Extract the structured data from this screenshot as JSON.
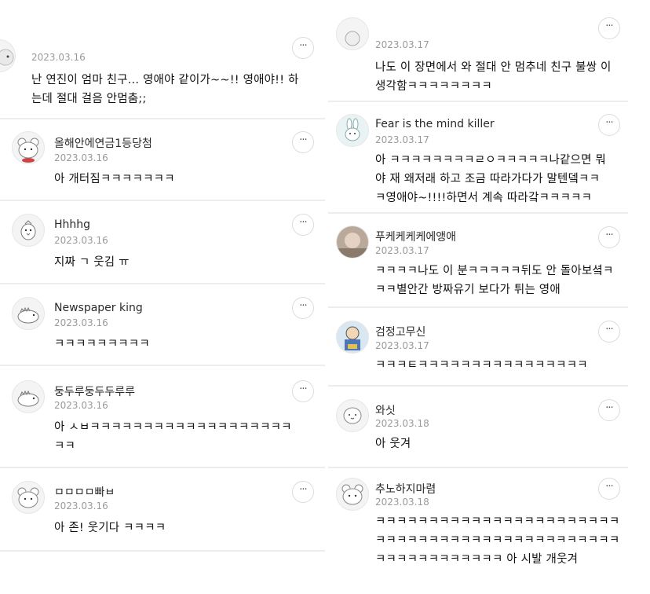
{
  "left_column": [
    {
      "username": "",
      "date": "2023.03.16",
      "text": "난 연진이 엄마 친구... 영애야 같이가~~!! 영애야!! 하\n는데 절대 걸음 안멈춤;;",
      "avatar_icon": "animal-avatar-icon"
    },
    {
      "username": "올해안에연금1등당첨",
      "date": "2023.03.16",
      "text": "아 개터짐ㅋㅋㅋㅋㅋㅋㅋ",
      "avatar_icon": "bear-avatar-icon"
    },
    {
      "username": "Hhhhg",
      "date": "2023.03.16",
      "text": "지짜 ㄱ 웃김 ㅠ",
      "avatar_icon": "chick-avatar-icon"
    },
    {
      "username": "Newspaper king",
      "date": "2023.03.16",
      "text": "ㅋㅋㅋㅋㅋㅋㅋㅋㅋ",
      "avatar_icon": "dinosaur-avatar-icon"
    },
    {
      "username": "둥두루둥두두루루",
      "date": "2023.03.16",
      "text": "아 ㅅㅂㅋㅋㅋㅋㅋㅋㅋㅋㅋㅋㅋㅋㅋㅋㅋㅋㅋㅋㅋ\nㅋㅋ",
      "avatar_icon": "dinosaur-avatar-icon"
    },
    {
      "username": "ㅁㅁㅁㅁ빠ㅂ",
      "date": "2023.03.16",
      "text": "아 존! 웃기다 ㅋㅋㅋㅋ",
      "avatar_icon": "bear-avatar-icon"
    }
  ],
  "right_column": [
    {
      "username": "",
      "date": "2023.03.17",
      "text": "나도 이 장면에서 와 절대 안 멈추네 친구 불쌍 이\n생각함ㅋㅋㅋㅋㅋㅋㅋㅋ",
      "avatar_icon": "animal-avatar-icon"
    },
    {
      "username": "Fear is the mind killer",
      "date": "2023.03.17",
      "text": "아 ㅋㅋㅋㅋㅋㅋㅋㅋㄹㅇㅋㅋㅋㅋㅋ나같으면 뭐\n야 재 왜저래 하고 조금 따라가다가 말텐뎈ㅋㅋ\nㅋ영애야~!!!!하면서 계속 따라갘ㅋㅋㅋㅋㅋ",
      "avatar_icon": "rabbit-avatar-icon"
    },
    {
      "username": "푸케케케케에앵애",
      "date": "2023.03.17",
      "text": "ㅋㅋㅋㅋ나도 이 분ㅋㅋㅋㅋㅋ뒤도 안 돌아보셬ㅋ\nㅋㅋ별안간 방짜유기 보다가 튀는 영애",
      "avatar_icon": "photo-avatar-icon"
    },
    {
      "username": "검정고무신",
      "date": "2023.03.17",
      "text": "ㅋㅋㅋㅌㅋㅋㅋㅋㅋㅋㅋㅋㅋㅋㅋㅋㅋㅋㅋㅋ",
      "avatar_icon": "cartoon-avatar-icon"
    },
    {
      "username": "와싯",
      "date": "2023.03.18",
      "text": "아 웃겨",
      "avatar_icon": "ghost-avatar-icon"
    },
    {
      "username": "추노하지마렴",
      "date": "2023.03.18",
      "text": "ㅋㅋㅋㅋㅋㅋㅋㅋㅋㅋㅋㅋㅋㅋㅋㅋㅋㅋㅋㅋㅋㅋㅋ\nㅋㅋㅋㅋㅋㅋㅋㅋㅋㅋㅋㅋㅋㅋㅋㅋㅋㅋㅋㅋㅋㅋㅋ\nㅋㅋㅋㅋㅋㅋㅋㅋㅋㅋㅋㅋ 아 시발 개웃겨",
      "avatar_icon": "bear-avatar-icon"
    }
  ],
  "more_button_label": "···"
}
